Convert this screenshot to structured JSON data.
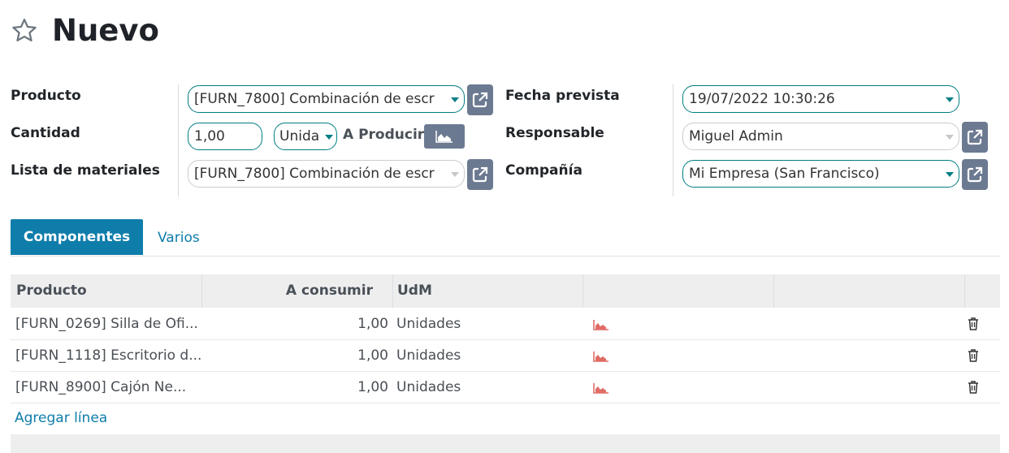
{
  "header": {
    "title": "Nuevo",
    "favorite_icon": "star-outline-icon"
  },
  "form": {
    "left": {
      "product_label": "Producto",
      "product_value": "[FURN_7800] Combinación de escr",
      "quantity_label": "Cantidad",
      "quantity_value": "1,00",
      "uom_value": "Unida",
      "to_produce_label": "A Producir",
      "bom_label": "Lista de materiales",
      "bom_value": "[FURN_7800] Combinación de escr"
    },
    "right": {
      "date_label": "Fecha prevista",
      "date_value": "19/07/2022 10:30:26",
      "responsible_label": "Responsable",
      "responsible_value": "Miguel Admin",
      "company_label": "Compañía",
      "company_value": "Mi Empresa (San Francisco)"
    }
  },
  "tabs": [
    {
      "label": "Componentes",
      "active": true
    },
    {
      "label": "Varios",
      "active": false
    }
  ],
  "table": {
    "columns": [
      "Producto",
      "A consumir",
      "UdM"
    ],
    "rows": [
      {
        "product": "[FURN_0269] Silla de Ofi...",
        "qty": "1,00",
        "uom": "Unidades"
      },
      {
        "product": "[FURN_1118] Escritorio d...",
        "qty": "1,00",
        "uom": "Unidades"
      },
      {
        "product": "[FURN_8900] Cajón Ne...",
        "qty": "1,00",
        "uom": "Unidades"
      }
    ],
    "add_line_label": "Agregar línea"
  },
  "colors": {
    "primary": "#0f7daa",
    "accent_teal": "#017e84",
    "button_grey": "#6c7a91",
    "forecast_red": "#e06c66"
  }
}
